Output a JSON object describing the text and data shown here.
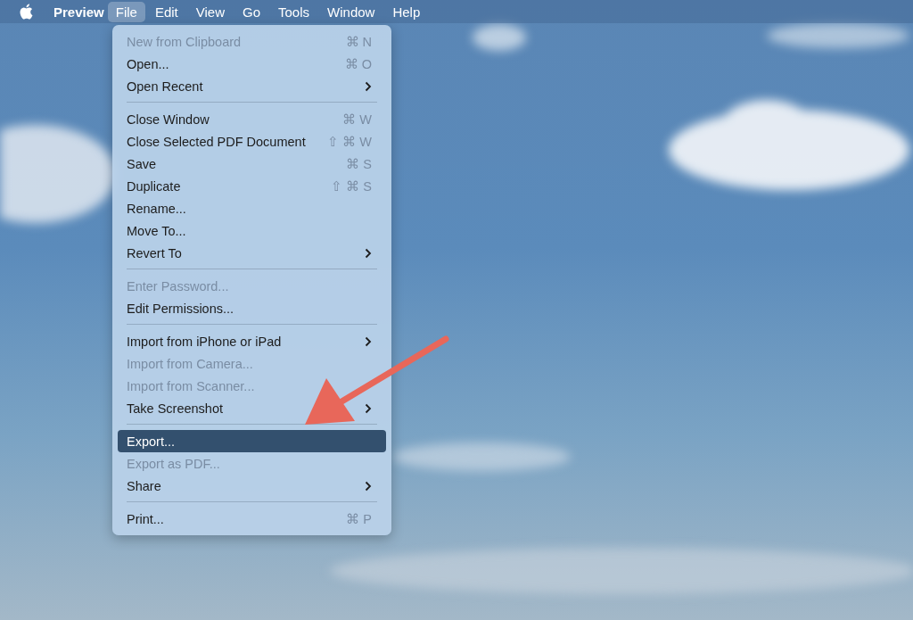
{
  "menu_bar": {
    "app_name": "Preview",
    "items": [
      {
        "label": "File",
        "selected": true
      },
      {
        "label": "Edit",
        "selected": false
      },
      {
        "label": "View",
        "selected": false
      },
      {
        "label": "Go",
        "selected": false
      },
      {
        "label": "Tools",
        "selected": false
      },
      {
        "label": "Window",
        "selected": false
      },
      {
        "label": "Help",
        "selected": false
      }
    ]
  },
  "file_menu": {
    "items": [
      {
        "kind": "item",
        "label": "New from Clipboard",
        "shortcut": "⌘ N",
        "submenu": false,
        "disabled": true,
        "selected": false
      },
      {
        "kind": "item",
        "label": "Open...",
        "shortcut": "⌘ O",
        "submenu": false,
        "disabled": false,
        "selected": false
      },
      {
        "kind": "item",
        "label": "Open Recent",
        "submenu": true,
        "disabled": false,
        "selected": false
      },
      {
        "kind": "separator"
      },
      {
        "kind": "item",
        "label": "Close Window",
        "shortcut": "⌘ W",
        "submenu": false,
        "disabled": false,
        "selected": false
      },
      {
        "kind": "item",
        "label": "Close Selected PDF Document",
        "shortcut": "⇧ ⌘ W",
        "submenu": false,
        "disabled": false,
        "selected": false
      },
      {
        "kind": "item",
        "label": "Save",
        "shortcut": "⌘ S",
        "submenu": false,
        "disabled": false,
        "selected": false
      },
      {
        "kind": "item",
        "label": "Duplicate",
        "shortcut": "⇧ ⌘ S",
        "submenu": false,
        "disabled": false,
        "selected": false
      },
      {
        "kind": "item",
        "label": "Rename...",
        "submenu": false,
        "disabled": false,
        "selected": false
      },
      {
        "kind": "item",
        "label": "Move To...",
        "submenu": false,
        "disabled": false,
        "selected": false
      },
      {
        "kind": "item",
        "label": "Revert To",
        "submenu": true,
        "disabled": false,
        "selected": false
      },
      {
        "kind": "separator"
      },
      {
        "kind": "item",
        "label": "Enter Password...",
        "submenu": false,
        "disabled": true,
        "selected": false
      },
      {
        "kind": "item",
        "label": "Edit Permissions...",
        "submenu": false,
        "disabled": false,
        "selected": false
      },
      {
        "kind": "separator"
      },
      {
        "kind": "item",
        "label": "Import from iPhone or iPad",
        "submenu": true,
        "disabled": false,
        "selected": false
      },
      {
        "kind": "item",
        "label": "Import from Camera...",
        "submenu": false,
        "disabled": true,
        "selected": false
      },
      {
        "kind": "item",
        "label": "Import from Scanner...",
        "submenu": false,
        "disabled": true,
        "selected": false
      },
      {
        "kind": "item",
        "label": "Take Screenshot",
        "submenu": true,
        "disabled": false,
        "selected": false
      },
      {
        "kind": "separator"
      },
      {
        "kind": "item",
        "label": "Export...",
        "submenu": false,
        "disabled": false,
        "selected": true
      },
      {
        "kind": "item",
        "label": "Export as PDF...",
        "submenu": false,
        "disabled": true,
        "selected": false
      },
      {
        "kind": "item",
        "label": "Share",
        "submenu": true,
        "disabled": false,
        "selected": false
      },
      {
        "kind": "separator"
      },
      {
        "kind": "item",
        "label": "Print...",
        "shortcut": "⌘ P",
        "submenu": false,
        "disabled": false,
        "selected": false
      }
    ]
  }
}
